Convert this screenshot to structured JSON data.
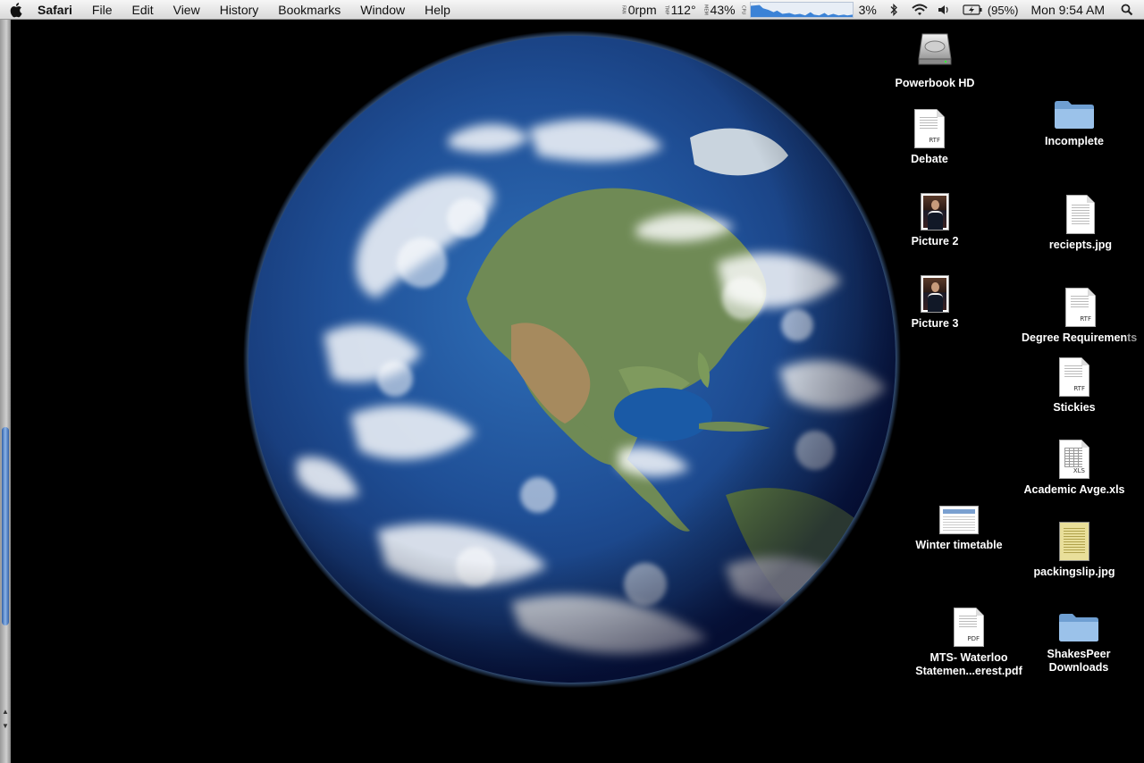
{
  "menubar": {
    "app_name": "Safari",
    "menus": [
      "File",
      "Edit",
      "View",
      "History",
      "Bookmarks",
      "Window",
      "Help"
    ],
    "status": {
      "fan_label": "FAN",
      "fan_value": "0rpm",
      "temp_label": "TMP",
      "temp_value": "112°",
      "mem_label": "MEM",
      "mem_value": "43%",
      "cpu_label": "CPU",
      "cpu_value": "3%",
      "battery_value": "(95%)",
      "clock": "Mon 9:54 AM"
    }
  },
  "desktop": {
    "icons": {
      "powerbook_hd": "Powerbook HD",
      "incomplete": "Incomplete",
      "debate": "Debate",
      "picture_2": "Picture 2",
      "reciepts": "reciepts.jpg",
      "picture_3": "Picture 3",
      "degree_requirements": "Degree Requiremen",
      "degree_requirements_tail": "ts",
      "stickies": "Stickies",
      "academic_avge": "Academic Avge.xls",
      "winter_timetable": "Winter timetable",
      "packingslip": "packingslip.jpg",
      "mts_line1": "MTS- Waterloo",
      "mts_line2": "Statemen...erest.pdf",
      "shakespeer_line1": "ShakesPeer",
      "shakespeer_line2": "Downloads"
    },
    "tags": {
      "rtf": "RTF",
      "xls": "XLS",
      "pdf": "PDF"
    }
  },
  "colors": {
    "menubar_top": "#f6f6f6",
    "menubar_bottom": "#d9d9d9",
    "desktop_bg": "#000000",
    "folder_blue": "#8fb6df",
    "cpu_graph": "#3b82d6"
  }
}
